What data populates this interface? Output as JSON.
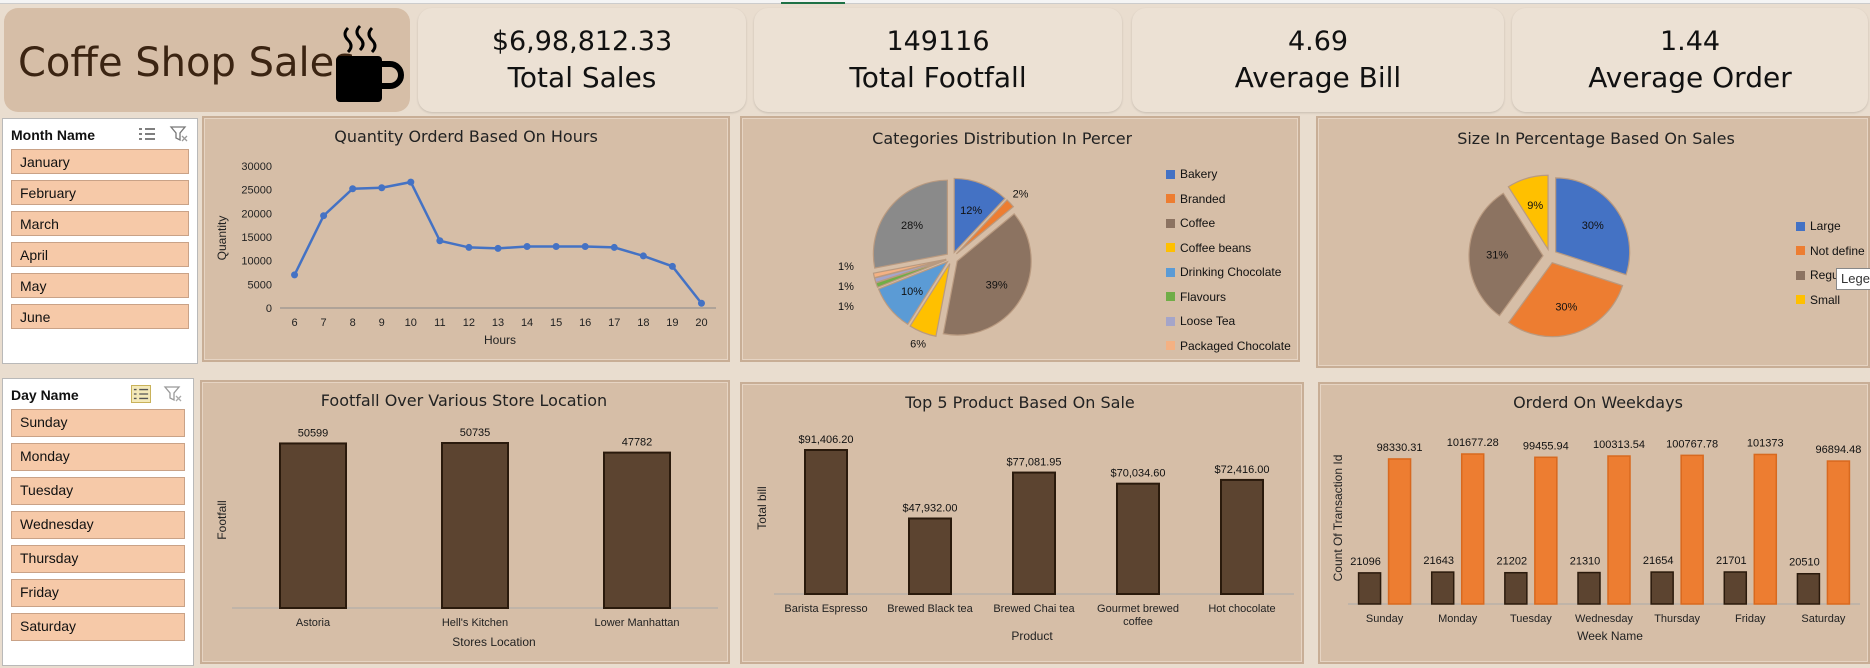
{
  "header": {
    "title": "Coffe Shop Sales",
    "kpis": [
      {
        "value": "$6,98,812.33",
        "label": "Total Sales"
      },
      {
        "value": "149116",
        "label": "Total Footfall"
      },
      {
        "value": "4.69",
        "label": "Average Bill"
      },
      {
        "value": "1.44",
        "label": "Average Order"
      }
    ]
  },
  "slicers": {
    "month": {
      "title": "Month Name",
      "items": [
        "January",
        "February",
        "March",
        "April",
        "May",
        "June"
      ]
    },
    "day": {
      "title": "Day Name",
      "items": [
        "Sunday",
        "Monday",
        "Tuesday",
        "Wednesday",
        "Thursday",
        "Friday",
        "Saturday"
      ]
    }
  },
  "tooltip": "Legend",
  "colors": {
    "brown_bar": "#5c4430",
    "orange": "#ed7d31",
    "blue": "#4472c4",
    "gray": "#8c7361",
    "yellow": "#ffc000"
  },
  "chart_data": [
    {
      "type": "line",
      "title": "Quantity Orderd Based On Hours",
      "xlabel": "Hours",
      "ylabel": "Quantity",
      "x": [
        6,
        7,
        8,
        9,
        10,
        11,
        12,
        13,
        14,
        15,
        16,
        17,
        18,
        19,
        20
      ],
      "values": [
        7000,
        19500,
        25200,
        25400,
        26600,
        14200,
        12800,
        12600,
        13000,
        13000,
        13000,
        12800,
        11000,
        8800,
        1000
      ],
      "yticks": [
        0,
        5000,
        10000,
        15000,
        20000,
        25000,
        30000
      ],
      "ylim": [
        0,
        30000
      ]
    },
    {
      "type": "pie",
      "title": "Categories Distribution In Percentage",
      "categories": [
        "Bakery",
        "Branded",
        "Coffee",
        "Coffee beans",
        "Drinking Chocolate",
        "Flavours",
        "Loose Tea",
        "Packaged Chocolate"
      ],
      "values": [
        12,
        2,
        39,
        6,
        10,
        1,
        1,
        1
      ],
      "labels": [
        "12%",
        "2%",
        "39%",
        "6%",
        "10%",
        "1%",
        "1%",
        "1%"
      ],
      "extra_slice": {
        "value": 28,
        "label": "28%"
      },
      "colors": [
        "#4472c4",
        "#ed7d31",
        "#8c7361",
        "#ffc000",
        "#5b9bd5",
        "#70ad47",
        "#a5a5c9",
        "#f4b183"
      ],
      "legend": "right"
    },
    {
      "type": "pie",
      "title": "Size In Percentage Based On Sales",
      "categories": [
        "Large",
        "Not define",
        "Regular",
        "Small"
      ],
      "legend_labels": [
        "Large",
        "Not define",
        "Regu",
        "Small"
      ],
      "values": [
        30,
        30,
        31,
        9
      ],
      "labels": [
        "30%",
        "30%",
        "31%",
        "9%"
      ],
      "colors": [
        "#4472c4",
        "#ed7d31",
        "#8c7361",
        "#ffc000"
      ],
      "legend": "right"
    },
    {
      "type": "bar",
      "title": "Footfall Over Various Store Location",
      "xlabel": "Stores Location",
      "ylabel": "Footfall",
      "categories": [
        "Astoria",
        "Hell's Kitchen",
        "Lower Manhattan"
      ],
      "values": [
        50599,
        50735,
        47782
      ],
      "labels": [
        "50599",
        "50735",
        "47782"
      ]
    },
    {
      "type": "bar",
      "title": "Top 5 Product  Based On Sale",
      "xlabel": "Product",
      "ylabel": "Total bill",
      "categories": [
        "Barista Espresso",
        "Brewed Black tea",
        "Brewed Chai tea",
        "Gourmet brewed coffee",
        "Hot chocolate"
      ],
      "values": [
        91406.2,
        47932.0,
        77081.95,
        70034.6,
        72416.0
      ],
      "labels": [
        "$91,406.20",
        "$47,932.00",
        "$77,081.95",
        "$70,034.60",
        "$72,416.00"
      ]
    },
    {
      "type": "bar",
      "title": "Orderd On Weekdays",
      "xlabel": "Week Name",
      "ylabel": "Count Of Transaction Id",
      "categories": [
        "Sunday",
        "Monday",
        "Tuesday",
        "Wednesday",
        "Thursday",
        "Friday",
        "Saturday"
      ],
      "series": [
        {
          "values": [
            21096,
            21643,
            21202,
            21310,
            21654,
            21701,
            20510
          ],
          "labels": [
            "21096",
            "21643",
            "21202",
            "21310",
            "21654",
            "21701",
            "20510"
          ]
        },
        {
          "values": [
            98330.31,
            101677.28,
            99455.94,
            100313.54,
            100767.78,
            101373,
            96894.48
          ],
          "labels": [
            "98330.31",
            "101677.28",
            "99455.94",
            "100313.54",
            "100767.78",
            "101373",
            "96894.48"
          ]
        }
      ]
    }
  ]
}
